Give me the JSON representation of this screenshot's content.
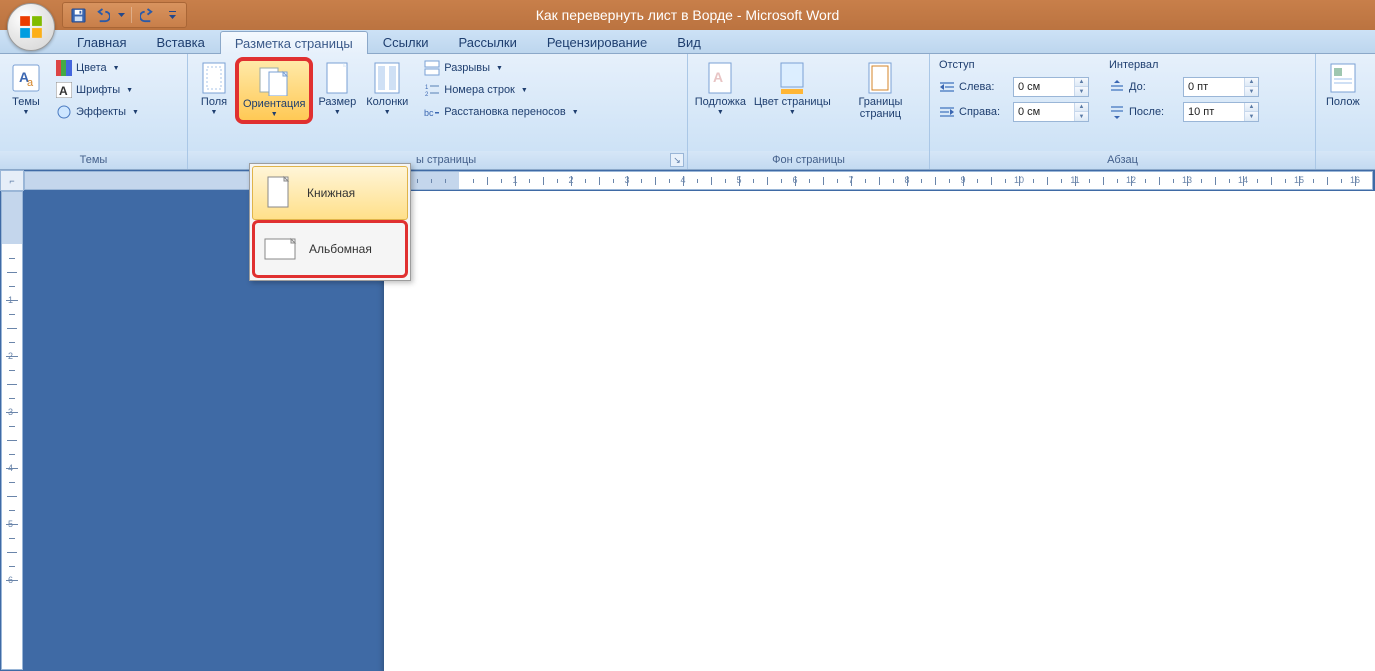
{
  "title": "Как перевернуть лист в Ворде - Microsoft Word",
  "tabs": {
    "home": "Главная",
    "insert": "Вставка",
    "layout": "Разметка страницы",
    "refs": "Ссылки",
    "mail": "Рассылки",
    "review": "Рецензирование",
    "view": "Вид"
  },
  "groups": {
    "themes": {
      "label": "Темы",
      "themes_btn": "Темы",
      "colors": "Цвета",
      "fonts": "Шрифты",
      "effects": "Эффекты"
    },
    "page_setup": {
      "label_fragment": "ы страницы",
      "margins": "Поля",
      "orientation": "Ориентация",
      "size": "Размер",
      "columns": "Колонки",
      "breaks": "Разрывы",
      "line_numbers": "Номера строк",
      "hyphenation": "Расстановка переносов"
    },
    "page_bg": {
      "label": "Фон страницы",
      "watermark": "Подложка",
      "page_color": "Цвет страницы",
      "borders": "Границы страниц"
    },
    "paragraph": {
      "label": "Абзац",
      "indent_head": "Отступ",
      "spacing_head": "Интервал",
      "left": "Слева:",
      "right": "Справа:",
      "before": "До:",
      "after": "После:",
      "left_val": "0 см",
      "right_val": "0 см",
      "before_val": "0 пт",
      "after_val": "10 пт"
    },
    "arrange": {
      "position": "Полож"
    }
  },
  "orient_menu": {
    "portrait": "Книжная",
    "landscape": "Альбомная"
  },
  "ruler": {
    "h_labels": [
      "1",
      "2",
      "3",
      "4",
      "5",
      "6",
      "7",
      "8",
      "9",
      "10",
      "11",
      "12",
      "13",
      "14",
      "15",
      "16"
    ],
    "v_labels": [
      "1",
      "2",
      "3",
      "4",
      "5",
      "6"
    ]
  }
}
